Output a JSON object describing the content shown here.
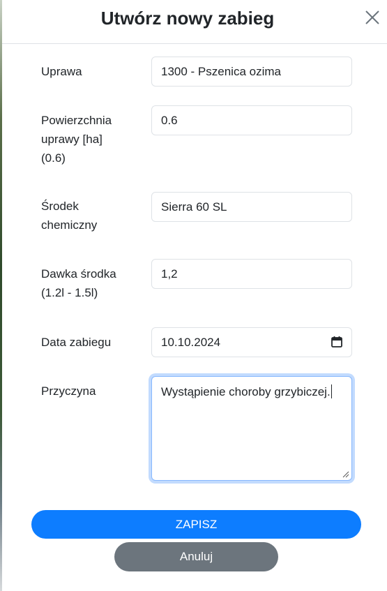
{
  "modal": {
    "title": "Utwórz nowy zabieg"
  },
  "form": {
    "crop": {
      "label": "Uprawa",
      "value": "1300 - Pszenica ozima"
    },
    "area": {
      "label": "Powierzchnia\nuprawy [ha]\n(0.6)",
      "value": "0.6"
    },
    "agent": {
      "label": "Środek\nchemiczny",
      "value": "Sierra 60 SL"
    },
    "dose": {
      "label": "Dawka środka\n(1.2l - 1.5l)",
      "value": "1,2"
    },
    "date": {
      "label": "Data zabiegu",
      "value": "10.10.2024"
    },
    "reason": {
      "label": "Przyczyna",
      "value": "Wystąpienie choroby grzybiczej."
    }
  },
  "buttons": {
    "save_label": "ZAPISZ",
    "cancel_label": "Anuluj"
  },
  "colors": {
    "primary": "#0d7dff",
    "secondary": "#6c757d",
    "focus_border": "#86b7fe"
  },
  "icons": {
    "close": "close-icon",
    "calendar": "calendar-icon",
    "resize": "resize-handle-icon"
  }
}
